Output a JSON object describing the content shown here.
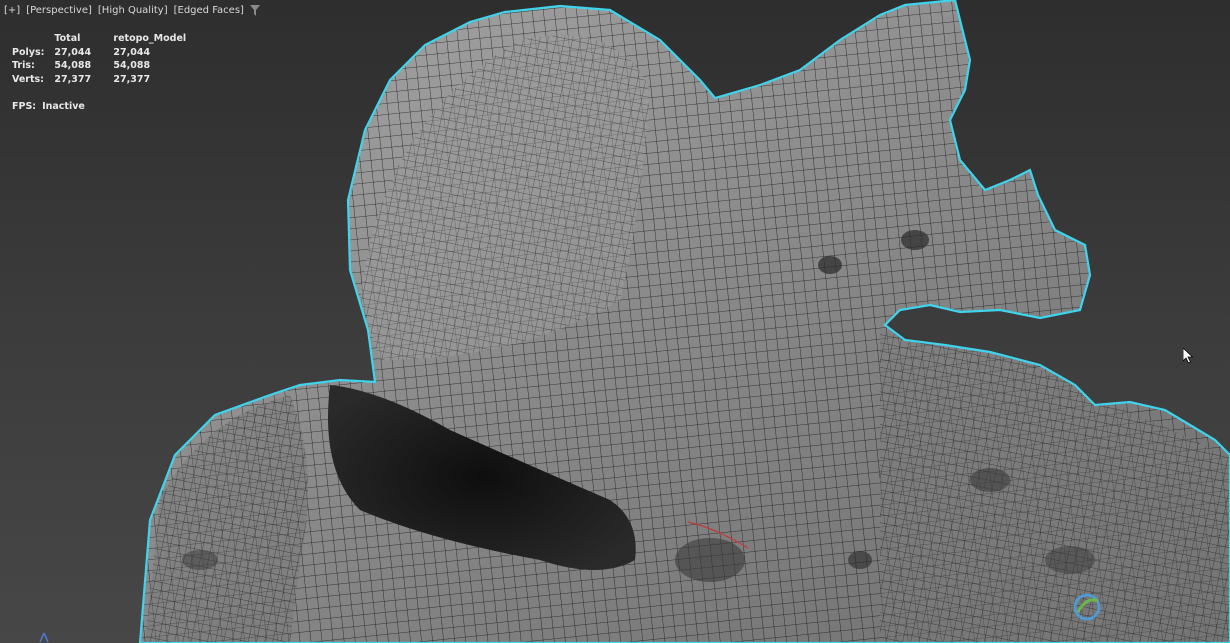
{
  "viewport": {
    "label_plus": "[+]",
    "label_view": "[Perspective]",
    "label_quality": "[High Quality]",
    "label_shading": "[Edged Faces]"
  },
  "stats": {
    "header_total": "Total",
    "header_object": "retopo_Model",
    "rows": [
      {
        "label": "Polys:",
        "total": "27,044",
        "object": "27,044"
      },
      {
        "label": "Tris:",
        "total": "54,088",
        "object": "54,088"
      },
      {
        "label": "Verts:",
        "total": "27,377",
        "object": "27,377"
      }
    ],
    "fps_label": "FPS:",
    "fps_value": "Inactive"
  },
  "colors": {
    "selection_outline": "#3fd3ec",
    "mesh_fill": "#8f8f8f",
    "wire": "#1c1c1c",
    "background": "#3a3a3a"
  },
  "icons": {
    "filter": "funnel-icon",
    "cursor": "mouse-pointer-icon",
    "axis": "axis-gizmo-icon"
  }
}
